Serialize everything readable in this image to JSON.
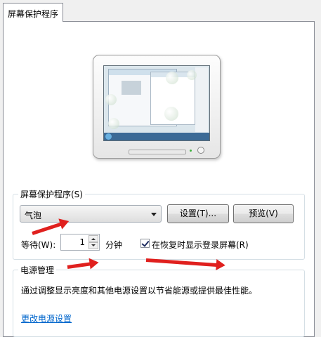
{
  "tab": {
    "label": "屏幕保护程序"
  },
  "screensaver": {
    "group_title": "屏幕保护程序(S)",
    "selected": "气泡",
    "settings_button": "设置(T)...",
    "preview_button": "预览(V)",
    "wait_label": "等待(W):",
    "wait_value": "1",
    "minute_label": "分钟",
    "resume_checkbox_label": "在恢复时显示登录屏幕(R)",
    "resume_checked": true
  },
  "power": {
    "group_title": "电源管理",
    "description": "通过调整显示亮度和其他电源设置以节省能源或提供最佳性能。",
    "link": "更改电源设置"
  },
  "colors": {
    "annotation_arrow": "#e0201e",
    "link": "#0066cc"
  },
  "icons": [
    "monitor-preview",
    "dropdown-arrow",
    "spinner-up",
    "spinner-down",
    "checkbox-checked"
  ]
}
